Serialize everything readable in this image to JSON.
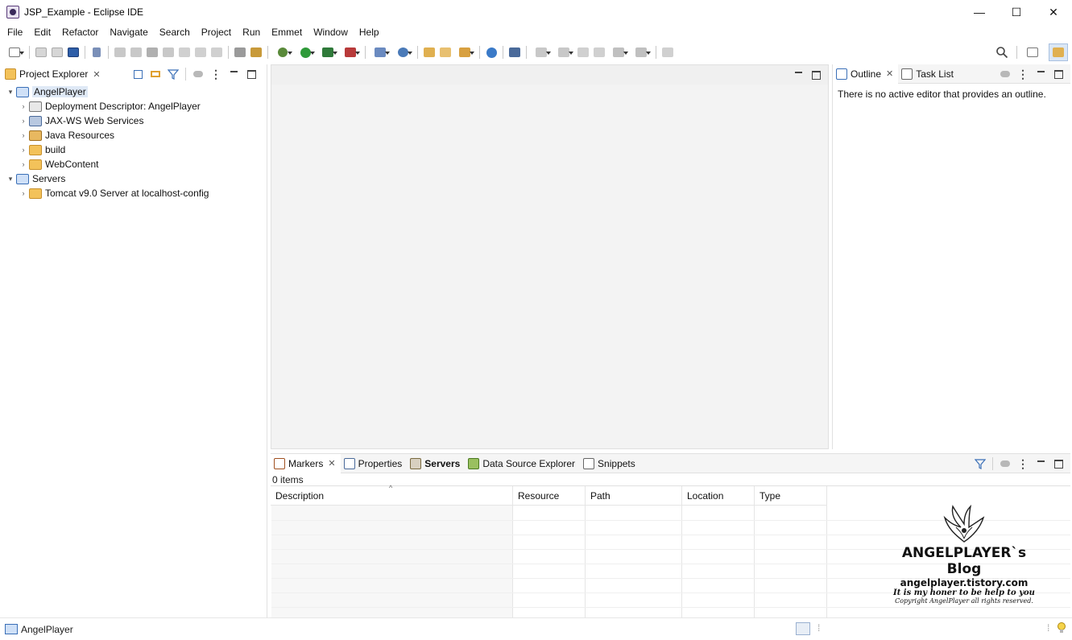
{
  "window": {
    "title": "JSP_Example - Eclipse IDE",
    "controls": {
      "minimize": "—",
      "maximize": "☐",
      "close": "✕"
    }
  },
  "menu": {
    "items": [
      "File",
      "Edit",
      "Refactor",
      "Navigate",
      "Search",
      "Project",
      "Run",
      "Emmet",
      "Window",
      "Help"
    ]
  },
  "project_explorer": {
    "tab_label": "Project Explorer",
    "tree": [
      {
        "label": "AngelPlayer",
        "expanded": true,
        "selected": true
      },
      {
        "label": "Deployment Descriptor: AngelPlayer"
      },
      {
        "label": "JAX-WS Web Services"
      },
      {
        "label": "Java Resources"
      },
      {
        "label": "build"
      },
      {
        "label": "WebContent"
      },
      {
        "label": "Servers",
        "expanded": true
      },
      {
        "label": "Tomcat v9.0 Server at localhost-config"
      }
    ]
  },
  "outline": {
    "tabs": [
      "Outline",
      "Task List"
    ],
    "message": "There is no active editor that provides an outline."
  },
  "bottom_panel": {
    "tabs": [
      "Markers",
      "Properties",
      "Servers",
      "Data Source Explorer",
      "Snippets"
    ],
    "count_text": "0 items",
    "columns": [
      "Description",
      "Resource",
      "Path",
      "Location",
      "Type"
    ]
  },
  "status_bar": {
    "text": "AngelPlayer"
  },
  "watermark": {
    "line1": "ANGELPLAYER`s Blog",
    "line2": "angelplayer.tistory.com",
    "line3": "It is my honer to be help to you",
    "line4": "Copyright AngelPlayer all rights reserved."
  },
  "colors": {
    "accent": "#3a6fb7",
    "folder": "#f3c25a",
    "selection": "#dfe9f6"
  }
}
